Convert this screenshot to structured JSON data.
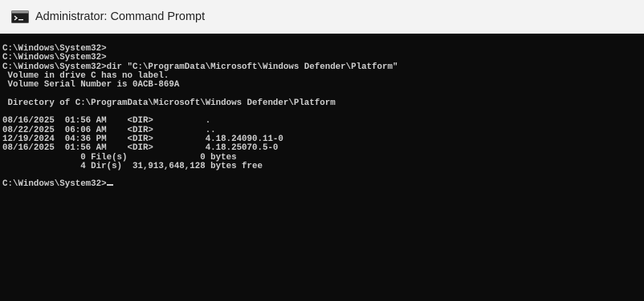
{
  "window": {
    "title": "Administrator: Command Prompt",
    "icon": "cmd-icon"
  },
  "console": {
    "lines": [
      "C:\\Windows\\System32>",
      "C:\\Windows\\System32>",
      "C:\\Windows\\System32>dir \"C:\\ProgramData\\Microsoft\\Windows Defender\\Platform\"",
      " Volume in drive C has no label.",
      " Volume Serial Number is 0ACB-869A",
      "",
      " Directory of C:\\ProgramData\\Microsoft\\Windows Defender\\Platform",
      "",
      "08/16/2025  01:56 AM    <DIR>          .",
      "08/22/2025  06:06 AM    <DIR>          ..",
      "12/19/2024  04:36 PM    <DIR>          4.18.24090.11-0",
      "08/16/2025  01:56 AM    <DIR>          4.18.25070.5-0",
      "               0 File(s)              0 bytes",
      "               4 Dir(s)  31,913,648,128 bytes free",
      ""
    ],
    "prompt": "C:\\Windows\\System32>"
  }
}
